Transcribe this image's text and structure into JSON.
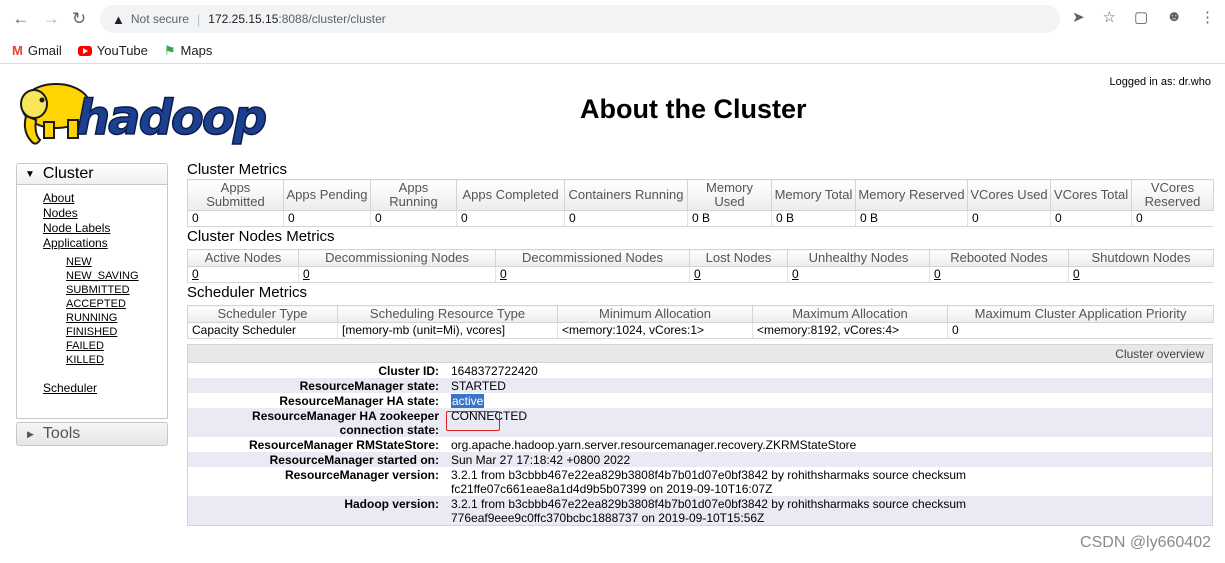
{
  "browser": {
    "security_label": "Not secure",
    "url_host": "172.25.15.15",
    "url_path": ":8088/cluster/cluster",
    "bookmarks": [
      {
        "label": "Gmail",
        "icon": "gmail-icon"
      },
      {
        "label": "YouTube",
        "icon": "youtube-icon"
      },
      {
        "label": "Maps",
        "icon": "maps-icon"
      }
    ]
  },
  "header": {
    "title": "About the Cluster",
    "logged_in": "Logged in as: dr.who",
    "logo_text": "hadoop"
  },
  "nav": {
    "cluster_label": "Cluster",
    "items": [
      "About",
      "Nodes",
      "Node Labels",
      "Applications"
    ],
    "app_states": [
      "NEW",
      "NEW_SAVING",
      "SUBMITTED",
      "ACCEPTED",
      "RUNNING",
      "FINISHED",
      "FAILED",
      "KILLED"
    ],
    "scheduler": "Scheduler",
    "tools_label": "Tools"
  },
  "cluster_metrics": {
    "title": "Cluster Metrics",
    "headers": [
      "Apps Submitted",
      "Apps Pending",
      "Apps Running",
      "Apps Completed",
      "Containers Running",
      "Memory Used",
      "Memory Total",
      "Memory Reserved",
      "VCores Used",
      "VCores Total",
      "VCores Reserved"
    ],
    "values": [
      "0",
      "0",
      "0",
      "0",
      "0",
      "0 B",
      "0 B",
      "0 B",
      "0",
      "0",
      "0"
    ]
  },
  "nodes_metrics": {
    "title": "Cluster Nodes Metrics",
    "headers": [
      "Active Nodes",
      "Decommissioning Nodes",
      "Decommissioned Nodes",
      "Lost Nodes",
      "Unhealthy Nodes",
      "Rebooted Nodes",
      "Shutdown Nodes"
    ],
    "values": [
      "0",
      "0",
      "0",
      "0",
      "0",
      "0",
      "0"
    ]
  },
  "scheduler_metrics": {
    "title": "Scheduler Metrics",
    "headers": [
      "Scheduler Type",
      "Scheduling Resource Type",
      "Minimum Allocation",
      "Maximum Allocation",
      "Maximum Cluster Application Priority"
    ],
    "values": [
      "Capacity Scheduler",
      "[memory-mb (unit=Mi), vcores]",
      "<memory:1024, vCores:1>",
      "<memory:8192, vCores:4>",
      "0"
    ]
  },
  "overview": {
    "title": "Cluster overview",
    "rows": [
      {
        "label": "Cluster ID:",
        "value": "1648372722420"
      },
      {
        "label": "ResourceManager state:",
        "value": "STARTED"
      },
      {
        "label": "ResourceManager HA state:",
        "value": "active"
      },
      {
        "label": "ResourceManager HA zookeeper connection state:",
        "value": "CONNECTED"
      },
      {
        "label": "ResourceManager RMStateStore:",
        "value": "org.apache.hadoop.yarn.server.resourcemanager.recovery.ZKRMStateStore"
      },
      {
        "label": "ResourceManager started on:",
        "value": "Sun Mar 27 17:18:42 +0800 2022"
      },
      {
        "label": "ResourceManager version:",
        "value": "3.2.1 from b3cbbb467e22ea829b3808f4b7b01d07e0bf3842 by rohithsharmaks source checksum fc21ffe07c661eae8a1d4d9b5b07399 on 2019-09-10T16:07Z"
      },
      {
        "label": "Hadoop version:",
        "value": "3.2.1 from b3cbbb467e22ea829b3808f4b7b01d07e0bf3842 by rohithsharmaks source checksum 776eaf9eee9c0ffc370bcbc1888737 on 2019-09-10T15:56Z"
      }
    ]
  },
  "watermark": "CSDN @ly660402"
}
